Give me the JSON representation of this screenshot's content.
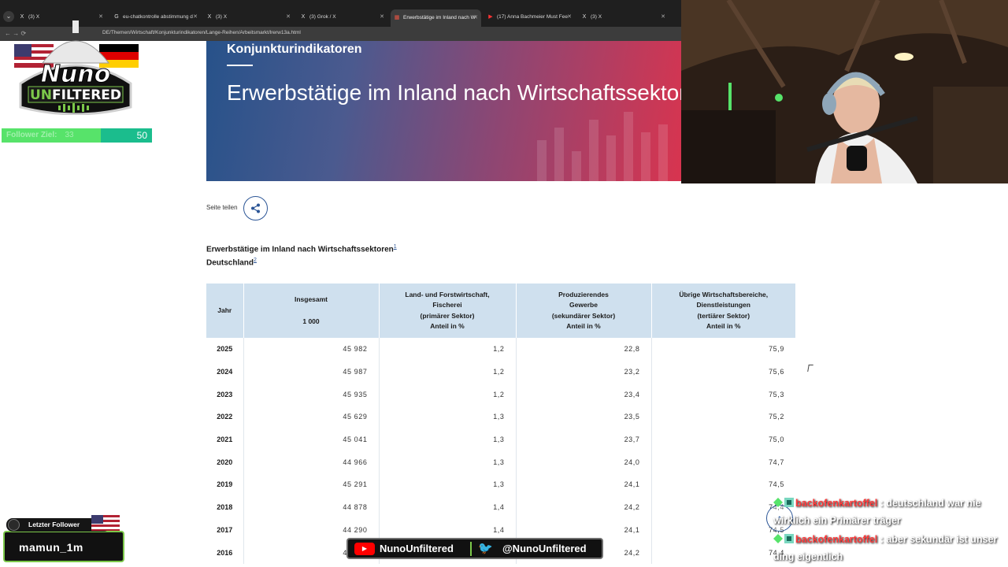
{
  "browser": {
    "tabs": [
      {
        "label": "(3) X",
        "favicon": "x-icon"
      },
      {
        "label": "eu-chatkontrolle abstimmung d",
        "favicon": "google-icon"
      },
      {
        "label": "(3) X",
        "favicon": "x-icon"
      },
      {
        "label": "(3) Grok / X",
        "favicon": "x-icon"
      },
      {
        "label": "Erwerbstätige im Inland nach W",
        "favicon": "destatis-icon",
        "active": true
      },
      {
        "label": "(17) Anna Bachmeier Must Fee",
        "favicon": "youtube-icon"
      },
      {
        "label": "(3) X",
        "favicon": "x-icon"
      }
    ],
    "url": "DE/Themen/Wirtschaft/Konjunkturindikatoren/Lange-Reihen/Arbeitsmarkt/lrerw13a.html"
  },
  "hero": {
    "kicker": "Konjunkturindikatoren",
    "headline": "Erwerbstätige im Inland nach Wirtschaftssektoren"
  },
  "share": {
    "label": "Seite teilen"
  },
  "table": {
    "title": "Erwerbstätige im Inland nach Wirtschaftssektoren",
    "title_footnote": "1",
    "subtitle": "Deutschland",
    "subtitle_footnote": "2",
    "headers": {
      "jahr": "Jahr",
      "insgesamt": "Insgesamt",
      "insgesamt_unit": "1 000",
      "primaer": [
        "Land- und Forstwirtschaft,",
        "Fischerei",
        "(primärer Sektor)",
        "Anteil in %"
      ],
      "sekundaer": [
        "Produzierendes",
        "Gewerbe",
        "(sekundärer Sektor)",
        "Anteil in %"
      ],
      "tertiaer": [
        "Übrige Wirtschaftsbereiche,",
        "Dienstleistungen",
        "(tertiärer Sektor)",
        "Anteil in %"
      ]
    },
    "rows": [
      {
        "year": "2025",
        "total": "45 982",
        "primary": "1,2",
        "secondary": "22,8",
        "tertiary": "75,9"
      },
      {
        "year": "2024",
        "total": "45 987",
        "primary": "1,2",
        "secondary": "23,2",
        "tertiary": "75,6"
      },
      {
        "year": "2023",
        "total": "45 935",
        "primary": "1,2",
        "secondary": "23,4",
        "tertiary": "75,3"
      },
      {
        "year": "2022",
        "total": "45 629",
        "primary": "1,3",
        "secondary": "23,5",
        "tertiary": "75,2"
      },
      {
        "year": "2021",
        "total": "45 041",
        "primary": "1,3",
        "secondary": "23,7",
        "tertiary": "75,0"
      },
      {
        "year": "2020",
        "total": "44 966",
        "primary": "1,3",
        "secondary": "24,0",
        "tertiary": "74,7"
      },
      {
        "year": "2019",
        "total": "45 291",
        "primary": "1,3",
        "secondary": "24,1",
        "tertiary": "74,5"
      },
      {
        "year": "2018",
        "total": "44 878",
        "primary": "1,4",
        "secondary": "24,2",
        "tertiary": "74,4"
      },
      {
        "year": "2017",
        "total": "44 290",
        "primary": "1,4",
        "secondary": "24,1",
        "tertiary": "74,5"
      },
      {
        "year": "2016",
        "total": "43 671",
        "primary": "1,4",
        "secondary": "24,2",
        "tertiary": "74,4"
      }
    ]
  },
  "overlay": {
    "logo_text": [
      "Nuno",
      "UNFILTERED"
    ],
    "follower_goal": {
      "label": "Follower Ziel:",
      "current": "33",
      "target": "50",
      "progress_fraction": 0.66,
      "bar_color": "#1bbd8d",
      "fill_color": "#57e36a"
    },
    "last_follower": {
      "label": "Letzter Follower",
      "name": "mamun_1m"
    },
    "social": {
      "youtube": "NunoUnfiltered",
      "twitter": "@NunoUnfiltered"
    },
    "chat": [
      {
        "user": "backofenkartoffel",
        "text": ": deutschland war nie wirklich ein Primärer träger"
      },
      {
        "user": "backofenkartoffel",
        "text": ": aber sekundär ist unser ding eigentlich"
      }
    ]
  },
  "colors": {
    "table_header_bg": "#cfe0ee",
    "link_blue": "#2b5596",
    "chat_user": "#ff3b3b"
  }
}
